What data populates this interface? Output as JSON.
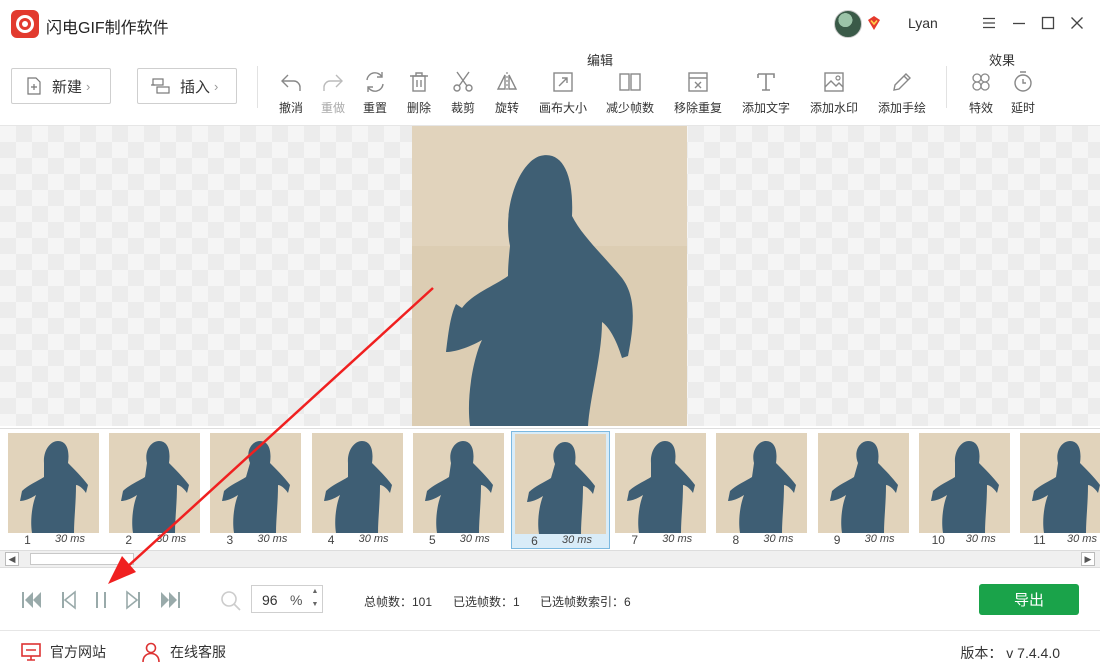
{
  "window": {
    "title": "闪电GIF制作软件",
    "username": "Lyan",
    "accent_color": "#e23a2e"
  },
  "toolbar": {
    "new_label": "新建",
    "insert_label": "插入",
    "edit_group_label": "编辑",
    "effects_group_label": "效果",
    "tools": [
      {
        "label": "撤消",
        "icon": "undo-icon",
        "enabled": true
      },
      {
        "label": "重做",
        "icon": "redo-icon",
        "enabled": false
      },
      {
        "label": "重置",
        "icon": "reset-icon",
        "enabled": true
      },
      {
        "label": "删除",
        "icon": "trash-icon",
        "enabled": true
      },
      {
        "label": "裁剪",
        "icon": "scissors-icon",
        "enabled": true
      },
      {
        "label": "旋转",
        "icon": "flip-icon",
        "enabled": true
      },
      {
        "label": "画布大小",
        "icon": "resize-icon",
        "enabled": true
      },
      {
        "label": "减少帧数",
        "icon": "reduce-frames-icon",
        "enabled": true
      },
      {
        "label": "移除重复",
        "icon": "remove-duplicate-icon",
        "enabled": true
      },
      {
        "label": "添加文字",
        "icon": "text-icon",
        "enabled": true
      },
      {
        "label": "添加水印",
        "icon": "watermark-icon",
        "enabled": true
      },
      {
        "label": "添加手绘",
        "icon": "pencil-icon",
        "enabled": true
      }
    ],
    "effects": [
      {
        "label": "特效",
        "icon": "effects-icon"
      },
      {
        "label": "延时",
        "icon": "timer-icon"
      }
    ]
  },
  "filmstrip": {
    "selected_index": 6,
    "frames": [
      {
        "num": "1",
        "dur": "30 ms"
      },
      {
        "num": "2",
        "dur": "30 ms"
      },
      {
        "num": "3",
        "dur": "30 ms"
      },
      {
        "num": "4",
        "dur": "30 ms"
      },
      {
        "num": "5",
        "dur": "30 ms"
      },
      {
        "num": "6",
        "dur": "30 ms"
      },
      {
        "num": "7",
        "dur": "30 ms"
      },
      {
        "num": "8",
        "dur": "30 ms"
      },
      {
        "num": "9",
        "dur": "30 ms"
      },
      {
        "num": "10",
        "dur": "30 ms"
      },
      {
        "num": "11",
        "dur": "30 ms"
      }
    ]
  },
  "playback": {
    "zoom_value": "96",
    "zoom_unit": "%",
    "total_frames": "总帧数：101",
    "selected_frames": "已选帧数：1",
    "selected_index": "已选帧数索引：6",
    "export_label": "导出",
    "export_color": "#1aa34a"
  },
  "footer": {
    "website_label": "官方网站",
    "support_label": "在线客服",
    "version": "版本： v 7.4.4.0"
  }
}
